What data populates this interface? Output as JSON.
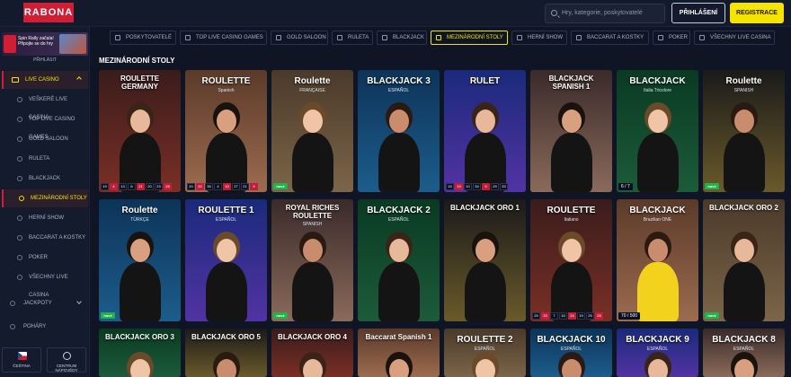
{
  "header": {
    "logo": "RABONA",
    "search_placeholder": "Hry, kategorie, poskytovatelé",
    "login_label": "PŘIHLÁŠENÍ",
    "register_label": "REGISTRACE"
  },
  "sidebar": {
    "promo_text": "Spin Rally začala! Připojte se do hry",
    "login_link": "PŘIHLÁSIT",
    "live_casino": "LIVE CASINO",
    "items": [
      "VEŠKERÉ LIVE CASINA",
      "TOP LIVE CASINO GAMES",
      "GOLD SALOON",
      "RULETA",
      "BLACKJACK",
      "MEZINÁRODNÍ STOLY",
      "HERNÍ SHOW",
      "BACCARAT A KOSTKY",
      "POKER",
      "VŠECHNY LIVE CASINA"
    ],
    "jackpots": "JACKPOTY",
    "poharY": "POHÁRY",
    "language": "ČEŠTINA",
    "help_center": "CENTRUM NÁPOVĚDY"
  },
  "tabs": [
    "POSKYTOVATELÉ",
    "TOP LIVE CASINO GAMES",
    "GOLD SALOON",
    "RULETA",
    "BLACKJACK",
    "MEZINÁRODNÍ STOLY",
    "HERNÍ SHOW",
    "BACCARAT A KOSTKY",
    "POKER",
    "VŠECHNY LIVE CASINA"
  ],
  "section_title": "MEZINÁRODNÍ STOLY",
  "new_badge": "nové",
  "games_row1": [
    {
      "title": "ROULETTE GERMANY",
      "sub": "",
      "stats": [
        "19",
        "4",
        "13",
        "6",
        "21",
        "20",
        "23",
        "28"
      ]
    },
    {
      "title": "ROULETTE",
      "sub": "Spanish",
      "stats": [
        "20",
        "32",
        "35",
        "4",
        "10",
        "27",
        "21",
        "9"
      ]
    },
    {
      "title": "Roulette",
      "sub": "FRANÇAISE",
      "stats": []
    },
    {
      "title": "BLACKJACK 3",
      "sub": "ESPAÑOL",
      "stats": []
    },
    {
      "title": "RULET",
      "sub": "",
      "stats": [
        "15",
        "19",
        "10",
        "34",
        "9",
        "29",
        "33"
      ]
    },
    {
      "title": "BLACKJACK SPANISH 1",
      "sub": "",
      "stats": []
    },
    {
      "title": "BLACKJACK",
      "sub": "Italia Tricolore",
      "seats": "6 / 7"
    },
    {
      "title": "Roulette",
      "sub": "SPANISH",
      "stats": []
    }
  ],
  "games_row2": [
    {
      "title": "Roulette",
      "sub": "TÜRKÇE"
    },
    {
      "title": "ROULETTE 1",
      "sub": "ESPAÑOL"
    },
    {
      "title": "ROYAL RICHES ROULETTE",
      "sub": "SPANISH"
    },
    {
      "title": "BLACKJACK 2",
      "sub": "ESPAÑOL"
    },
    {
      "title": "BLACKJACK ORO 1",
      "sub": ""
    },
    {
      "title": "ROULETTE",
      "sub": "Italiano",
      "stats": [
        "25",
        "33",
        "7",
        "15",
        "24",
        "19",
        "25",
        "28"
      ]
    },
    {
      "title": "BLACKJACK",
      "sub": "Brazilian ONE",
      "seats": "70 / 500"
    },
    {
      "title": "BLACKJACK ORO 2",
      "sub": ""
    }
  ],
  "games_row3": [
    {
      "title": "BLACKJACK ORO 3"
    },
    {
      "title": "BLACKJACK ORO 5"
    },
    {
      "title": "BLACKJACK ORO 4"
    },
    {
      "title": "Baccarat Spanish 1"
    },
    {
      "title": "ROULETTE 2",
      "sub": "ESPAÑOL"
    },
    {
      "title": "BLACKJACK 10",
      "sub": "ESPAÑOL"
    },
    {
      "title": "BLACKJACK 9",
      "sub": "ESPAÑOL"
    },
    {
      "title": "BLACKJACK 8",
      "sub": "ESPAÑOL"
    }
  ],
  "colors": {
    "accent_yellow": "#f5e300",
    "brand_red": "#d21e35",
    "bg": "#0f1524"
  }
}
